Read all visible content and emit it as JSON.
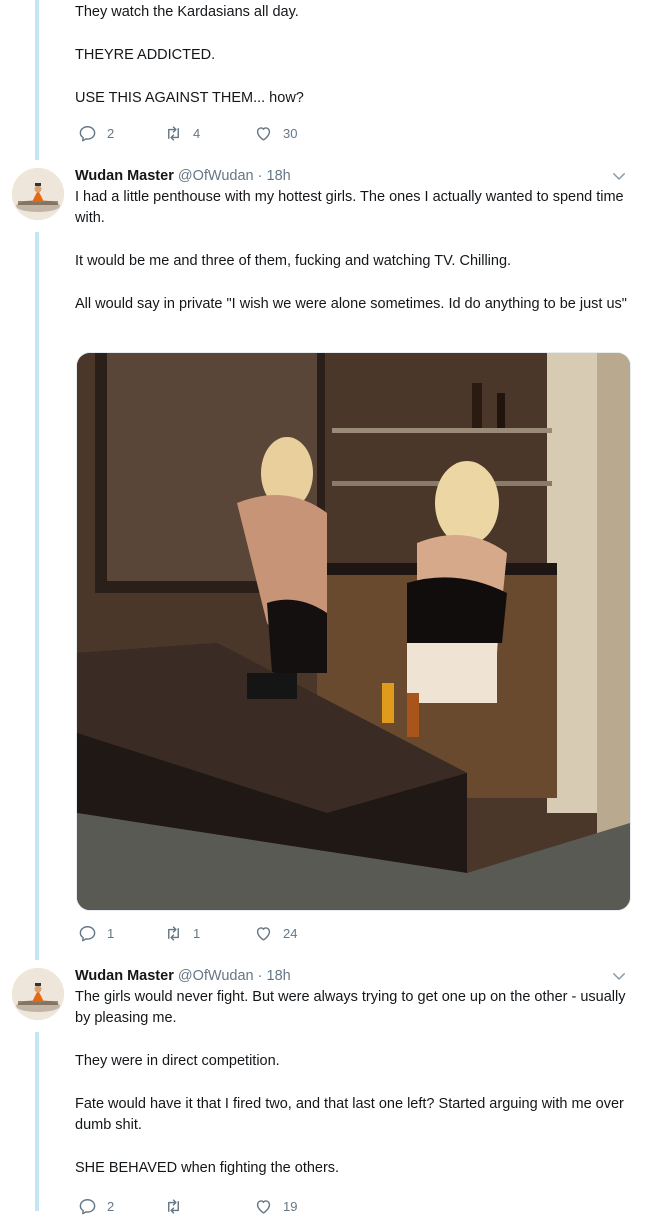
{
  "thread": {
    "line_color": "#c4e7f5"
  },
  "top_tweet": {
    "lines": [
      "They watch the Kardasians all day.",
      "THEYRE ADDICTED.",
      "USE THIS AGAINST THEM... how?"
    ],
    "replies": "2",
    "retweets": "4",
    "likes": "30"
  },
  "tweet2": {
    "author": "Wudan Master",
    "handle": "@OfWudan",
    "separator": "·",
    "time": "18h",
    "paragraphs": [
      "I had a little penthouse with my hottest girls. The ones I actually wanted to spend time with.",
      "It would be me and three of them, fucking and watching TV. Chilling.",
      "All would say in private \"I wish we were alone sometimes. Id do anything to be just us\""
    ],
    "replies": "1",
    "retweets": "1",
    "likes": "24"
  },
  "tweet3": {
    "author": "Wudan Master",
    "handle": "@OfWudan",
    "separator": "·",
    "time": "18h",
    "paragraphs": [
      "The girls would never fight. But were always trying to get one up on the other - usually by pleasing me.",
      "They were in direct competition.",
      "Fate would have it that I fired two, and that last one left? Started arguing with me over dumb shit.",
      "SHE BEHAVED when fighting the others."
    ],
    "replies": "2",
    "likes": "19"
  },
  "icons": {
    "reply": "reply-icon",
    "retweet": "retweet-icon",
    "like": "heart-icon",
    "more": "chevron-down-icon"
  },
  "colors": {
    "text": "#14171a",
    "muted": "#657786"
  }
}
